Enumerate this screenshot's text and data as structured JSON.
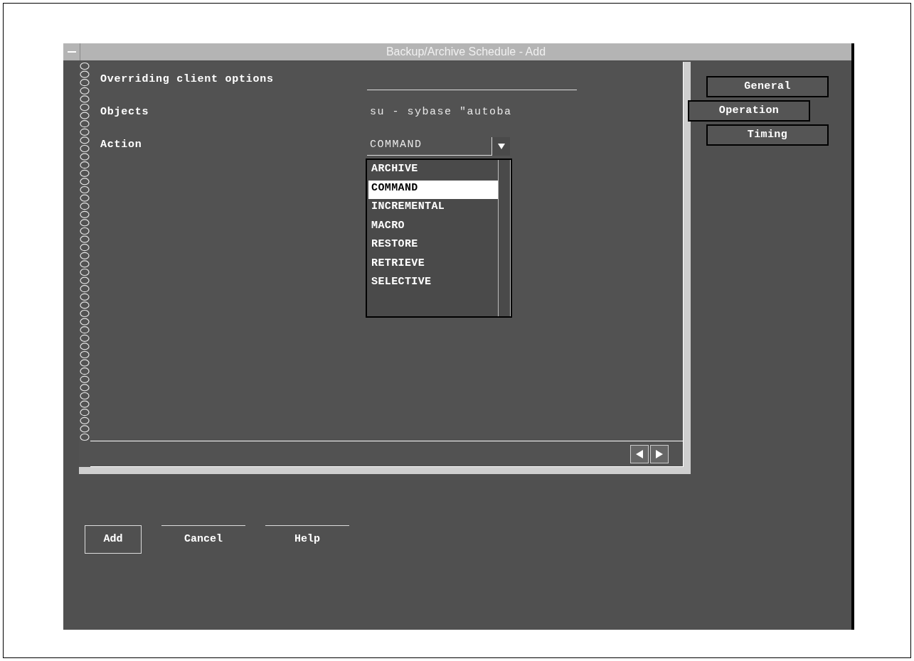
{
  "window": {
    "title": "Backup/Archive Schedule - Add"
  },
  "fields": [
    {
      "kind": "text",
      "label": "Overriding client options"
    },
    {
      "kind": "text",
      "label": "Objects",
      "value": "su - sybase \"autoba"
    },
    {
      "kind": "combo",
      "label": "Action",
      "value": "COMMAND",
      "open": true,
      "options": [
        {
          "label": "ARCHIVE",
          "selected": false
        },
        {
          "label": "COMMAND",
          "selected": true
        },
        {
          "label": "INCREMENTAL",
          "selected": false
        },
        {
          "label": "MACRO",
          "selected": false
        },
        {
          "label": "RESTORE",
          "selected": false
        },
        {
          "label": "RETRIEVE",
          "selected": false
        },
        {
          "label": "SELECTIVE",
          "selected": false
        }
      ]
    }
  ],
  "tabs": [
    {
      "label": "General",
      "selected": false
    },
    {
      "label": "Operation",
      "selected": true
    },
    {
      "label": "Timing",
      "selected": false
    }
  ],
  "buttons": [
    "Add",
    "Cancel",
    "Help"
  ]
}
